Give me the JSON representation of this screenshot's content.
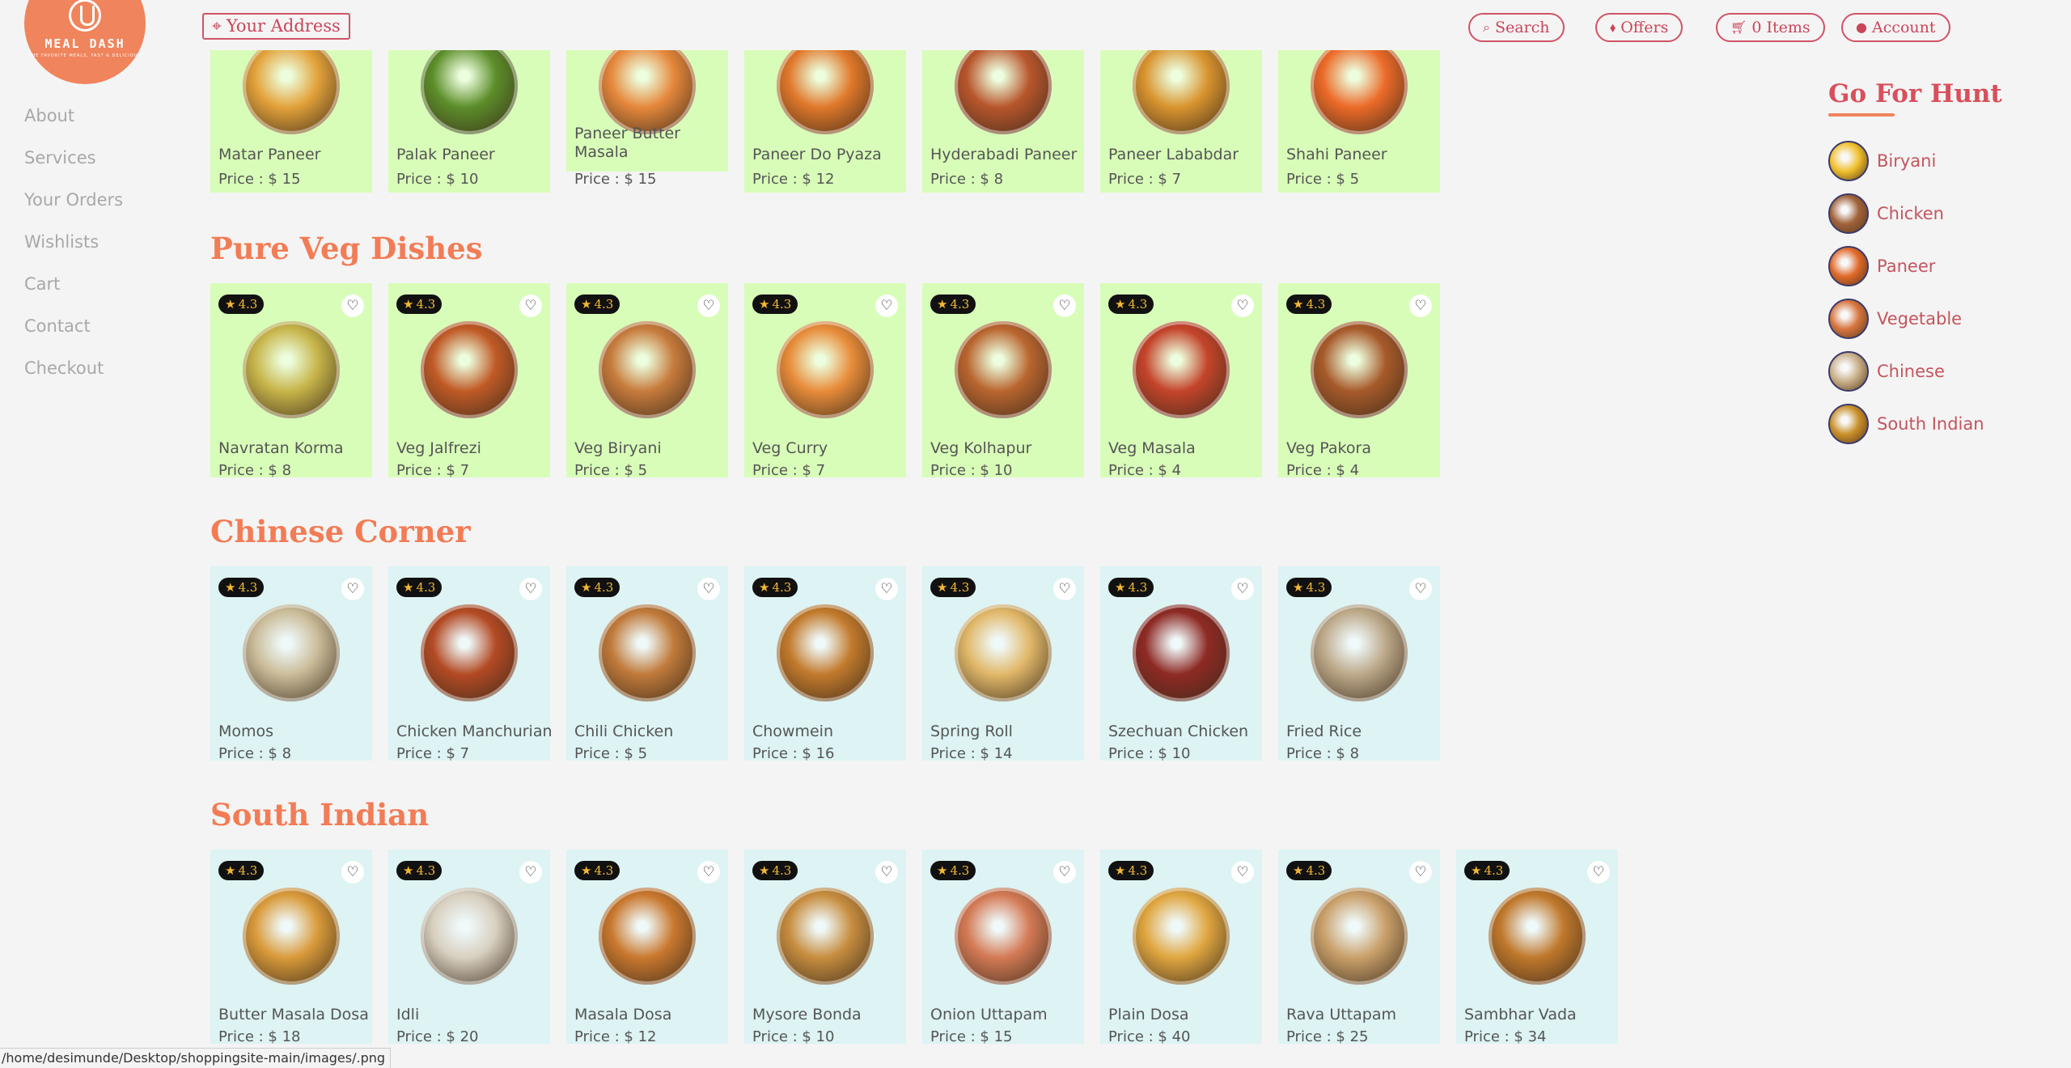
{
  "logo": {
    "brand": "MEAL DASH",
    "tagline": "THE FAVORITE MEALS, FAST & DELICIOUS"
  },
  "sidebar": {
    "items": [
      "About",
      "Services",
      "Your Orders",
      "Wishlists",
      "Cart",
      "Contact",
      "Checkout"
    ]
  },
  "header": {
    "address": "Your Address",
    "search": "Search",
    "offers": "Offers",
    "cart": "0 Items",
    "account": "Account"
  },
  "hunt": {
    "title": "Go For Hunt",
    "items": [
      {
        "label": "Biryani",
        "color": "#f2c12e"
      },
      {
        "label": "Chicken",
        "color": "#a0623a"
      },
      {
        "label": "Paneer",
        "color": "#e0692a"
      },
      {
        "label": "Vegetable",
        "color": "#d7753f"
      },
      {
        "label": "Chinese",
        "color": "#c9b08a"
      },
      {
        "label": "South Indian",
        "color": "#c9902a"
      }
    ]
  },
  "rating": "4.3",
  "price_prefix": "Price : $",
  "sections": [
    {
      "title": "",
      "theme": "green",
      "items": [
        {
          "name": "Matar Paneer",
          "price": "15",
          "color": "#e3a23a"
        },
        {
          "name": "Palak Paneer",
          "price": "10",
          "color": "#5c8e2a"
        },
        {
          "name": "Paneer Butter Masala",
          "price": "15",
          "color": "#e6883c"
        },
        {
          "name": "Paneer Do Pyaza",
          "price": "12",
          "color": "#e0782a"
        },
        {
          "name": "Hyderabadi Paneer",
          "price": "8",
          "color": "#b8562c"
        },
        {
          "name": "Paneer Lababdar",
          "price": "7",
          "color": "#d9942f"
        },
        {
          "name": "Shahi Paneer",
          "price": "5",
          "color": "#ec6a28"
        }
      ]
    },
    {
      "title": "Pure Veg Dishes",
      "theme": "green",
      "items": [
        {
          "name": "Navratan Korma",
          "price": "8",
          "color": "#c7b54a"
        },
        {
          "name": "Veg Jalfrezi",
          "price": "7",
          "color": "#c05a26"
        },
        {
          "name": "Veg Biryani",
          "price": "5",
          "color": "#c77b3c"
        },
        {
          "name": "Veg Curry",
          "price": "7",
          "color": "#e88c3a"
        },
        {
          "name": "Veg Kolhapur",
          "price": "10",
          "color": "#b9652f"
        },
        {
          "name": "Veg Masala",
          "price": "4",
          "color": "#c4442a"
        },
        {
          "name": "Veg Pakora",
          "price": "4",
          "color": "#a75a2a"
        }
      ]
    },
    {
      "title": "Chinese Corner",
      "theme": "blue",
      "items": [
        {
          "name": "Momos",
          "price": "8",
          "color": "#cbbd9a"
        },
        {
          "name": "Chicken Manchurian",
          "price": "7",
          "color": "#b34a24"
        },
        {
          "name": "Chili Chicken",
          "price": "5",
          "color": "#c07a3a"
        },
        {
          "name": "Chowmein",
          "price": "16",
          "color": "#c27a2c"
        },
        {
          "name": "Spring Roll",
          "price": "14",
          "color": "#e1b869"
        },
        {
          "name": "Szechuan Chicken",
          "price": "10",
          "color": "#8e2a24"
        },
        {
          "name": "Fried Rice",
          "price": "8",
          "color": "#bda98a"
        }
      ]
    },
    {
      "title": "South Indian",
      "theme": "blue",
      "items": [
        {
          "name": "Butter Masala Dosa",
          "price": "18",
          "color": "#d99a3a"
        },
        {
          "name": "Idli",
          "price": "20",
          "color": "#d8d0c0"
        },
        {
          "name": "Masala Dosa",
          "price": "12",
          "color": "#c9782e"
        },
        {
          "name": "Mysore Bonda",
          "price": "10",
          "color": "#c78d3f"
        },
        {
          "name": "Onion Uttapam",
          "price": "15",
          "color": "#d47a55"
        },
        {
          "name": "Plain Dosa",
          "price": "40",
          "color": "#e0a640"
        },
        {
          "name": "Rava Uttapam",
          "price": "25",
          "color": "#c9a06a"
        },
        {
          "name": "Sambhar Vada",
          "price": "34",
          "color": "#c0782c"
        }
      ]
    }
  ],
  "status_bar": "/home/desimunde/Desktop/shoppingsite-main/images/.png"
}
